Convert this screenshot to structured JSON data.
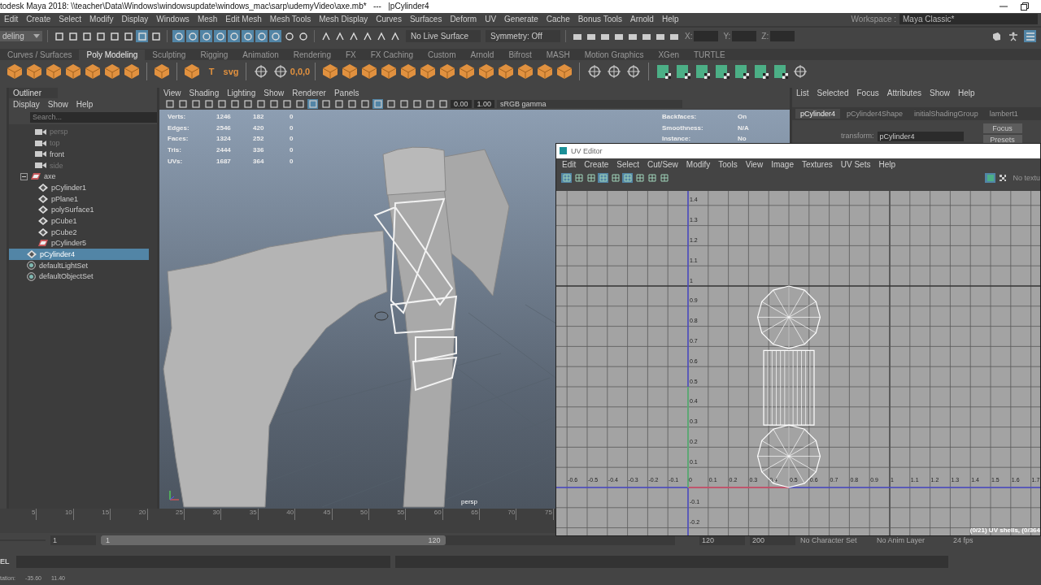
{
  "title_bar": {
    "title": "todesk Maya 2018: \\\\teacher\\Data\\Windows\\windowsupdate\\windows_mac\\sarp\\udemyVideo\\axe.mb*   ---   |pCylinder4"
  },
  "main_menu": [
    "Edit",
    "Create",
    "Select",
    "Modify",
    "Display",
    "Windows",
    "Mesh",
    "Edit Mesh",
    "Mesh Tools",
    "Mesh Display",
    "Curves",
    "Surfaces",
    "Deform",
    "UV",
    "Generate",
    "Cache",
    "Bonus Tools",
    "Arnold",
    "Help"
  ],
  "workspace": {
    "label": "Workspace :",
    "value": "Maya Classic*"
  },
  "status_line": {
    "mode": "deling",
    "live_surface": "No Live Surface",
    "symmetry": "Symmetry: Off",
    "coord_labels": [
      "X:",
      "Y:",
      "Z:"
    ],
    "tools": [
      {
        "highlighted": false
      },
      {
        "highlighted": false
      },
      {
        "highlighted": false
      },
      {
        "highlighted": false
      },
      {
        "highlighted": false
      },
      {
        "highlighted": false
      },
      {
        "highlighted": true
      },
      {
        "highlighted": false
      }
    ],
    "snap_tools": [
      {
        "highlighted": true
      },
      {
        "highlighted": true
      },
      {
        "highlighted": true
      },
      {
        "highlighted": true
      },
      {
        "highlighted": true
      },
      {
        "highlighted": true
      },
      {
        "highlighted": true
      },
      {
        "highlighted": true
      },
      {
        "highlighted": false
      },
      {
        "highlighted": false
      }
    ]
  },
  "shelf_tabs": [
    {
      "label": "Curves / Surfaces",
      "selected": false
    },
    {
      "label": "Poly Modeling",
      "selected": true
    },
    {
      "label": "Sculpting",
      "selected": false
    },
    {
      "label": "Rigging",
      "selected": false
    },
    {
      "label": "Animation",
      "selected": false
    },
    {
      "label": "Rendering",
      "selected": false
    },
    {
      "label": "FX",
      "selected": false
    },
    {
      "label": "FX Caching",
      "selected": false
    },
    {
      "label": "Custom",
      "selected": false
    },
    {
      "label": "Arnold",
      "selected": false
    },
    {
      "label": "Bifrost",
      "selected": false
    },
    {
      "label": "MASH",
      "selected": false
    },
    {
      "label": "Motion Graphics",
      "selected": false
    },
    {
      "label": "XGen",
      "selected": false
    },
    {
      "label": "TURTLE",
      "selected": false
    }
  ],
  "shelf_groups": [
    [
      {
        "kind": "poly"
      },
      {
        "kind": "poly"
      },
      {
        "kind": "poly"
      },
      {
        "kind": "poly"
      },
      {
        "kind": "poly"
      },
      {
        "kind": "poly"
      },
      {
        "kind": "poly"
      }
    ],
    [
      {
        "kind": "poly"
      }
    ],
    [
      {
        "kind": "poly"
      },
      {
        "kind": "text",
        "text": "T"
      },
      {
        "kind": "text",
        "text": "svg"
      }
    ],
    [
      {
        "kind": "tool"
      },
      {
        "kind": "tool"
      },
      {
        "kind": "text",
        "text": "0,0,0"
      }
    ],
    [
      {
        "kind": "poly"
      },
      {
        "kind": "poly"
      },
      {
        "kind": "poly"
      },
      {
        "kind": "poly"
      },
      {
        "kind": "poly"
      },
      {
        "kind": "poly"
      },
      {
        "kind": "poly"
      },
      {
        "kind": "poly"
      },
      {
        "kind": "poly"
      },
      {
        "kind": "poly"
      },
      {
        "kind": "poly"
      },
      {
        "kind": "poly"
      },
      {
        "kind": "poly"
      }
    ],
    [
      {
        "kind": "tool"
      },
      {
        "kind": "tool"
      },
      {
        "kind": "tool"
      }
    ],
    [
      {
        "kind": "uv"
      },
      {
        "kind": "uv"
      },
      {
        "kind": "uv"
      },
      {
        "kind": "uv"
      },
      {
        "kind": "uv"
      },
      {
        "kind": "uv"
      },
      {
        "kind": "uv"
      },
      {
        "kind": "tool"
      }
    ]
  ],
  "outliner": {
    "title": "Outliner",
    "menu": [
      "Display",
      "Show",
      "Help"
    ],
    "search_placeholder": "Search...",
    "items": [
      {
        "label": "persp",
        "kind": "camera",
        "hidden": true,
        "selected": false
      },
      {
        "label": "top",
        "kind": "camera",
        "hidden": true,
        "selected": false
      },
      {
        "label": "front",
        "kind": "camera",
        "hidden": false,
        "selected": false
      },
      {
        "label": "side",
        "kind": "camera",
        "hidden": true,
        "selected": false
      },
      {
        "label": "axe",
        "kind": "group",
        "hidden": false,
        "selected": false,
        "expanded": true,
        "children": [
          {
            "label": "pCylinder1",
            "kind": "mesh",
            "hidden": false,
            "selected": false
          },
          {
            "label": "pPlane1",
            "kind": "mesh",
            "hidden": false,
            "selected": false
          },
          {
            "label": "polySurface1",
            "kind": "mesh",
            "hidden": false,
            "selected": false
          },
          {
            "label": "pCube1",
            "kind": "mesh",
            "hidden": false,
            "selected": false
          },
          {
            "label": "pCube2",
            "kind": "mesh",
            "hidden": false,
            "selected": false
          },
          {
            "label": "pCylinder5",
            "kind": "group",
            "hidden": false,
            "selected": false
          }
        ]
      },
      {
        "label": "pCylinder4",
        "kind": "mesh",
        "hidden": false,
        "selected": true
      },
      {
        "label": "defaultLightSet",
        "kind": "set",
        "hidden": false,
        "selected": false
      },
      {
        "label": "defaultObjectSet",
        "kind": "set",
        "hidden": false,
        "selected": false
      }
    ]
  },
  "viewport": {
    "menu": [
      "View",
      "Shading",
      "Lighting",
      "Show",
      "Renderer",
      "Panels"
    ],
    "exposure": "0.00",
    "gamma": "1.00",
    "color_space": "sRGB gamma",
    "stats": [
      {
        "label": "Verts:",
        "values": [
          "1246",
          "182",
          "0"
        ]
      },
      {
        "label": "Edges:",
        "values": [
          "2546",
          "420",
          "0"
        ]
      },
      {
        "label": "Faces:",
        "values": [
          "1324",
          "252",
          "0"
        ]
      },
      {
        "label": "Tris:",
        "values": [
          "2444",
          "336",
          "0"
        ]
      },
      {
        "label": "UVs:",
        "values": [
          "1687",
          "364",
          "0"
        ]
      }
    ],
    "hud": [
      {
        "label": "Backfaces:",
        "value": "On"
      },
      {
        "label": "Smoothness:",
        "value": "N/A"
      },
      {
        "label": "Instance:",
        "value": "No"
      }
    ],
    "camera": "persp"
  },
  "channel_box": {
    "menu": [
      "List",
      "Selected",
      "Focus",
      "Attributes",
      "Show",
      "Help"
    ],
    "tabs": [
      {
        "label": "pCylinder4",
        "selected": true
      },
      {
        "label": "pCylinder4Shape",
        "selected": false
      },
      {
        "label": "initialShadingGroup",
        "selected": false
      },
      {
        "label": "lambert1",
        "selected": false
      }
    ],
    "transform_label": "transform:",
    "transform_value": "pCylinder4",
    "buttons": [
      "Focus",
      "Presets"
    ]
  },
  "uv_editor": {
    "title": "UV Editor",
    "menu": [
      "Edit",
      "Create",
      "Select",
      "Cut/Sew",
      "Modify",
      "Tools",
      "View",
      "Image",
      "Textures",
      "UV Sets",
      "Help"
    ],
    "texture_label": "No textu",
    "u_ticks": [
      "-0.6",
      "-0.5",
      "-0.4",
      "-0.3",
      "-0.2",
      "-0.1",
      "0",
      "0.1",
      "0.2",
      "0.3",
      "0.4",
      "0.5",
      "0.6",
      "0.7",
      "0.8",
      "0.9",
      "1",
      "1.1",
      "1.2",
      "1.3",
      "1.4",
      "1.5",
      "1.6",
      "1.7"
    ],
    "v_ticks_upper": [
      "1.4",
      "1.3",
      "1.2",
      "1.1",
      "1",
      "0.9",
      "0.8",
      "0.7",
      "0.6",
      "0.5",
      "0.4",
      "0.3",
      "0.2",
      "0.1"
    ],
    "v_ticks_lower": [
      "-0.1",
      "-0.2"
    ],
    "status": "(0/21) UV shells, (0/364"
  },
  "timeline": {
    "ticks": [
      "5",
      "10",
      "15",
      "20",
      "25",
      "30",
      "35",
      "40",
      "45",
      "50",
      "55",
      "60",
      "65",
      "70",
      "75"
    ]
  },
  "range": {
    "current": "1",
    "slider_start": "1",
    "range_end": "120",
    "level": 0.6,
    "end_fields": [
      "120",
      "200"
    ],
    "character_set": "No Character Set",
    "anim_layer": "No Anim Layer",
    "fps": "24 fps"
  },
  "command_line": {
    "language": "EL"
  },
  "help_line": {
    "label": "tation:",
    "values": [
      "-35.60",
      "11.40"
    ]
  }
}
